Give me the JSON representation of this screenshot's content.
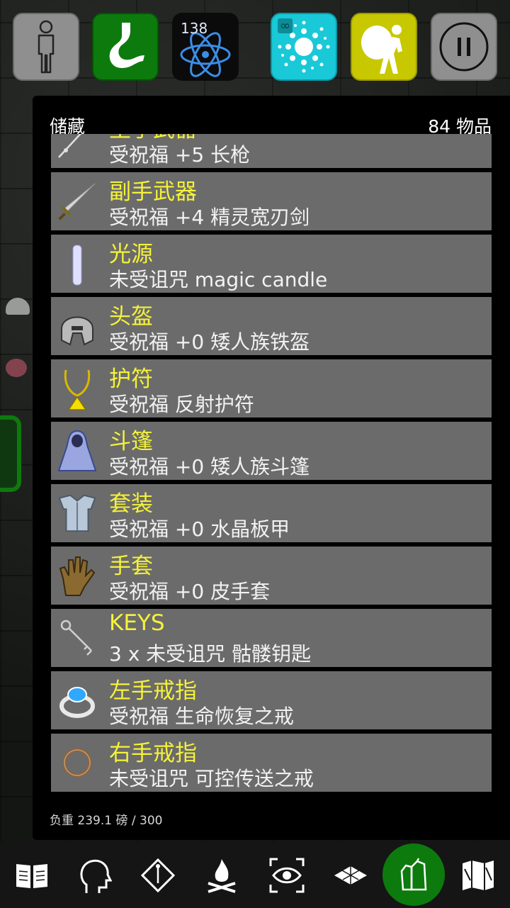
{
  "topbar": {
    "character_icon": "person-outline-icon",
    "hunger_icon": "stomach-icon",
    "xp_icon": "atom-icon",
    "xp_value": "138",
    "magic_icon": "burst-icon",
    "magic_corner": "∞",
    "load_icon": "carrying-sack-icon",
    "pause_icon": "pause-icon",
    "colors": {
      "hunger": "#0d7a0d",
      "magic": "#19c9d8",
      "load": "#c8c800"
    }
  },
  "panel": {
    "title": "储藏",
    "count": "84 物品",
    "weight": "负重 239.1 磅 / 300"
  },
  "items": [
    {
      "slot": "主手武器",
      "desc": "受祝福 +5 长枪",
      "icon": "lance-icon"
    },
    {
      "slot": "副手武器",
      "desc": "受祝福 +4 精灵宽刃剑",
      "icon": "sword-icon"
    },
    {
      "slot": "光源",
      "desc": "未受诅咒 magic candle",
      "icon": "candle-icon"
    },
    {
      "slot": "头盔",
      "desc": "受祝福 +0 矮人族铁盔",
      "icon": "helmet-icon"
    },
    {
      "slot": "护符",
      "desc": "受祝福 反射护符",
      "icon": "amulet-icon"
    },
    {
      "slot": "斗篷",
      "desc": "受祝福 +0 矮人族斗篷",
      "icon": "cloak-icon"
    },
    {
      "slot": "套装",
      "desc": "受祝福 +0 水晶板甲",
      "icon": "armor-icon"
    },
    {
      "slot": "手套",
      "desc": "受祝福 +0 皮手套",
      "icon": "glove-icon"
    },
    {
      "slot": "KEYS",
      "desc": "3 x 未受诅咒 骷髅钥匙",
      "icon": "key-icon"
    },
    {
      "slot": "左手戒指",
      "desc": "受祝福 生命恢复之戒",
      "icon": "gem-ring-icon"
    },
    {
      "slot": "右手戒指",
      "desc": "未受诅咒 可控传送之戒",
      "icon": "ring-icon"
    }
  ],
  "bottombar": [
    {
      "name": "spellbook-icon"
    },
    {
      "name": "head-profile-icon"
    },
    {
      "name": "diamond-figure-icon"
    },
    {
      "name": "campfire-icon"
    },
    {
      "name": "look-eye-icon"
    },
    {
      "name": "floor-tiles-icon"
    },
    {
      "name": "inventory-bags-icon",
      "active": true
    },
    {
      "name": "map-icon"
    }
  ]
}
